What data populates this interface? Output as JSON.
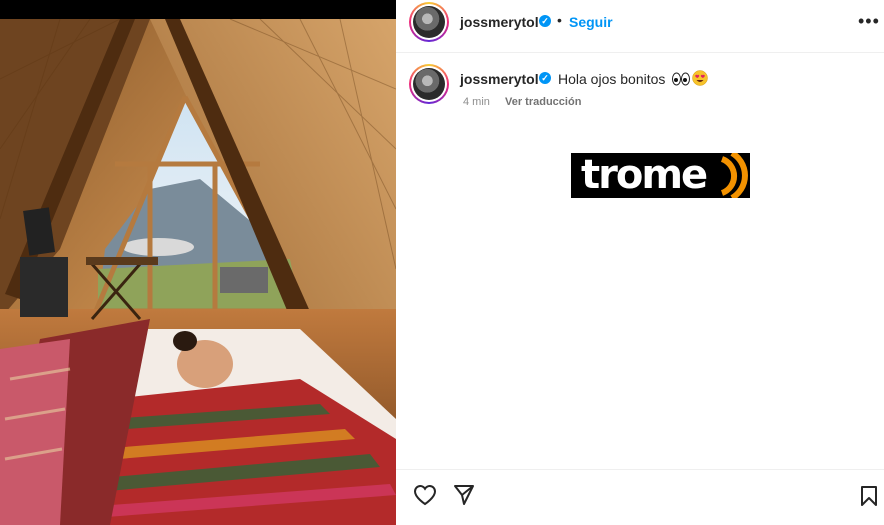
{
  "post": {
    "username": "jossmerytol",
    "follow_label": "Seguir",
    "separator": "•",
    "more_label": "•••",
    "caption": {
      "username": "jossmerytol",
      "text": "Hola ojos bonitos",
      "emojis": [
        "eyes-emoji",
        "heart-eyes-emoji"
      ],
      "time": "4 min",
      "translate_label": "Ver traducción"
    },
    "logo_text": "trome",
    "icons": {
      "like": "heart-icon",
      "share": "paper-plane-icon",
      "save": "bookmark-icon",
      "verified": "verified-badge-icon"
    }
  },
  "colors": {
    "link": "#0095f6",
    "text": "#262626",
    "muted": "#8e8e8e",
    "logo_accent": "#f39200"
  }
}
